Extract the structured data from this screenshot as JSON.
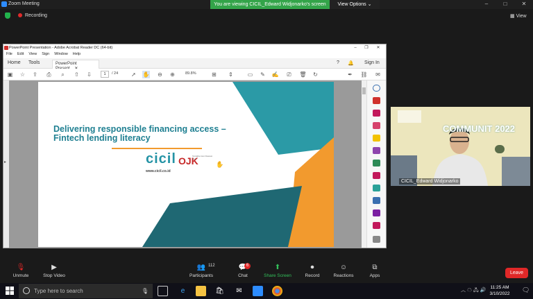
{
  "zoom": {
    "window_title": "Zoom Meeting",
    "share_banner": "You are viewing CICIL_Edward Widjonarko's screen",
    "view_options": "View Options",
    "recording": "Recording",
    "view": "View"
  },
  "acrobat": {
    "title": "PowerPoint Presentation - Adobe Acrobat Reader DC (64-bit)",
    "menu": [
      "File",
      "Edit",
      "View",
      "Sign",
      "Window",
      "Help"
    ],
    "tabs": [
      "Home",
      "Tools"
    ],
    "doc_tab": "PowerPoint Present...",
    "sign_in": "Sign In",
    "page_current": "1",
    "page_total": "/ 24",
    "zoom": "89.8%"
  },
  "slide": {
    "title_line1": "Delivering responsible financing access –",
    "title_line2": "Fintech lending literacy",
    "logo": "cicil",
    "ojk": "OJK",
    "ojk_caption": "Terdaftar dan Diawasi oleh",
    "url": "www.cicil.co.id"
  },
  "camera": {
    "name": "CICIL_Edward Widjonarko",
    "summit": "COMMUNIT 2022"
  },
  "toolbar": {
    "unmute": "Unmute",
    "stop_video": "Stop Video",
    "participants": "Participants",
    "participant_count": "112",
    "chat": "Chat",
    "chat_badge": "6",
    "share_screen": "Share Screen",
    "record": "Record",
    "reactions": "Reactions",
    "apps": "Apps",
    "leave": "Leave"
  },
  "taskbar": {
    "search_placeholder": "Type here to search",
    "time": "11:25 AM",
    "date": "3/10/2022"
  },
  "colors": {
    "zoom_green": "#33a449",
    "leave_red": "#e02828",
    "teal": "#1e7f91",
    "orange": "#f29a2e"
  }
}
